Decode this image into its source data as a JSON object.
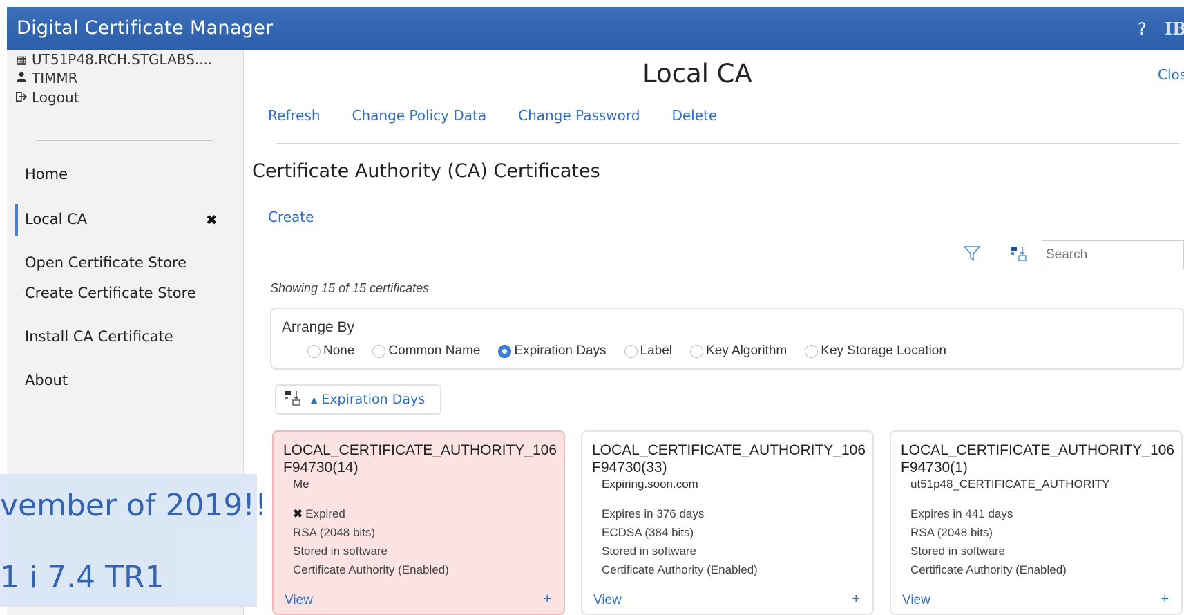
{
  "app": {
    "title": "Digital Certificate Manager",
    "help": "?",
    "logo": "IB"
  },
  "sidebar": {
    "system": "UT51P48.RCH.STGLABS....",
    "user": "TIMMR",
    "logout": "Logout",
    "nav": {
      "home": "Home",
      "local_ca": "Local CA",
      "open_store": "Open Certificate Store",
      "create_store": "Create Certificate Store",
      "install_ca": "Install CA Certificate",
      "about": "About"
    }
  },
  "banner": {
    "line1": "vember of 2019!!",
    "line2": "1 i 7.4 TR1"
  },
  "page": {
    "title": "Local CA",
    "close": "Clos",
    "actions": {
      "refresh": "Refresh",
      "change_policy": "Change Policy Data",
      "change_password": "Change Password",
      "delete": "Delete"
    },
    "section_title": "Certificate Authority (CA) Certificates",
    "create": "Create",
    "search_placeholder": "Search",
    "showing": "Showing 15 of 15 certificates"
  },
  "arrange": {
    "label": "Arrange By",
    "options": {
      "none": "None",
      "common_name": "Common Name",
      "expiration_days": "Expiration Days",
      "label": "Label",
      "key_algorithm": "Key Algorithm",
      "key_storage": "Key Storage Location"
    },
    "selected": "Expiration Days"
  },
  "sort": {
    "label": "Expiration Days",
    "direction": "ascending"
  },
  "cards": [
    {
      "name": "LOCAL_CERTIFICATE_AUTHORITY_106F94730(14)",
      "subject": "Me",
      "status": "Expired",
      "algorithm": "RSA (2048 bits)",
      "storage": "Stored in software",
      "role": "Certificate Authority (Enabled)",
      "view": "View",
      "expand": "+"
    },
    {
      "name": "LOCAL_CERTIFICATE_AUTHORITY_106F94730(33)",
      "subject": "Expiring.soon.com",
      "status": "Expires in 376 days",
      "algorithm": "ECDSA (384 bits)",
      "storage": "Stored in software",
      "role": "Certificate Authority (Enabled)",
      "view": "View",
      "expand": "+"
    },
    {
      "name": "LOCAL_CERTIFICATE_AUTHORITY_106F94730(1)",
      "subject": "ut51p48_CERTIFICATE_AUTHORITY",
      "status": "Expires in 441 days",
      "algorithm": "RSA (2048 bits)",
      "storage": "Stored in software",
      "role": "Certificate Authority (Enabled)",
      "view": "View",
      "expand": "+"
    }
  ],
  "colors": {
    "accent": "#2f6fc2",
    "titlebar": "#2c5ea9",
    "expired_bg": "#fbe3e3"
  }
}
